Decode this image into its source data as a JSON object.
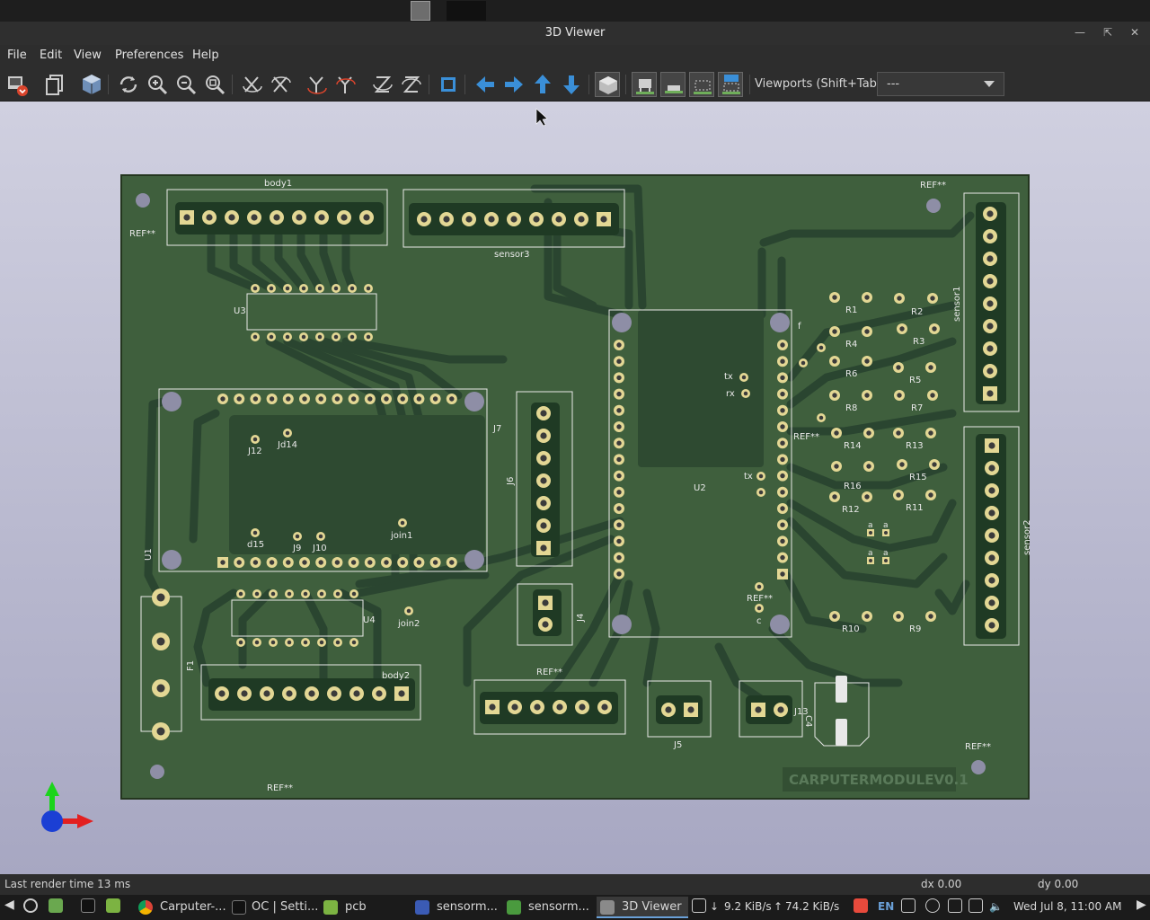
{
  "window": {
    "title": "3D Viewer"
  },
  "menu": [
    "File",
    "Edit",
    "View",
    "Preferences",
    "Help"
  ],
  "toolbar": {
    "icons": [
      "export-icon",
      "copy-icon",
      "raytrace-icon",
      "reload-icon",
      "zoom-in-icon",
      "zoom-out-icon",
      "zoom-fit-icon",
      "rotate-x-cw-icon",
      "rotate-x-ccw-icon",
      "rotate-y-cw-icon",
      "rotate-y-ccw-icon",
      "rotate-z-cw-icon",
      "rotate-z-ccw-icon",
      "flip-board-icon",
      "pan-left-icon",
      "pan-right-icon",
      "pan-up-icon",
      "pan-down-icon",
      "orthographic-icon",
      "show-tht-icon",
      "show-smd-icon",
      "show-virtual-icon",
      "show-not-in-pos-icon"
    ],
    "viewports_label": "Viewports (Shift+Tab):",
    "viewports_value": "---"
  },
  "pcb": {
    "silkscreen_labels": [
      "body1",
      "sensor3",
      "REF**",
      "U3",
      "U1",
      "J12",
      "Jd14",
      "d15",
      "J9",
      "J10",
      "join1",
      "J7",
      "J6",
      "U2",
      "tx",
      "rx",
      "f",
      "R1",
      "R2",
      "R3",
      "R4",
      "R5",
      "R6",
      "R7",
      "R8",
      "R9",
      "R10",
      "R11",
      "R12",
      "R13",
      "R14",
      "R15",
      "R16",
      "sensor1",
      "sensor2",
      "U4",
      "join2",
      "F1",
      "body2",
      "J4",
      "J5",
      "J13",
      "C4",
      "c",
      "a"
    ],
    "board_text": "CARPUTERMODULEV0.1"
  },
  "status": {
    "render_time": "Last render time 13 ms",
    "dx": "dx 0.00",
    "dy": "dy 0.00"
  },
  "taskbar": {
    "tasks": [
      "Carputer-...",
      "OC | Setti...",
      "pcb",
      "sensorm...",
      "sensorm...",
      "3D Viewer"
    ],
    "net_down": "9.2 KiB/s",
    "net_up": "74.2 KiB/s",
    "lang": "EN",
    "clock": "Wed Jul 8, 11:00 AM"
  },
  "colors": {
    "board": "#3f5f3d",
    "copper": "#2a4530",
    "pad": "#e3d794",
    "silk": "#e8e8e8",
    "drill": "#8e8ea6"
  }
}
